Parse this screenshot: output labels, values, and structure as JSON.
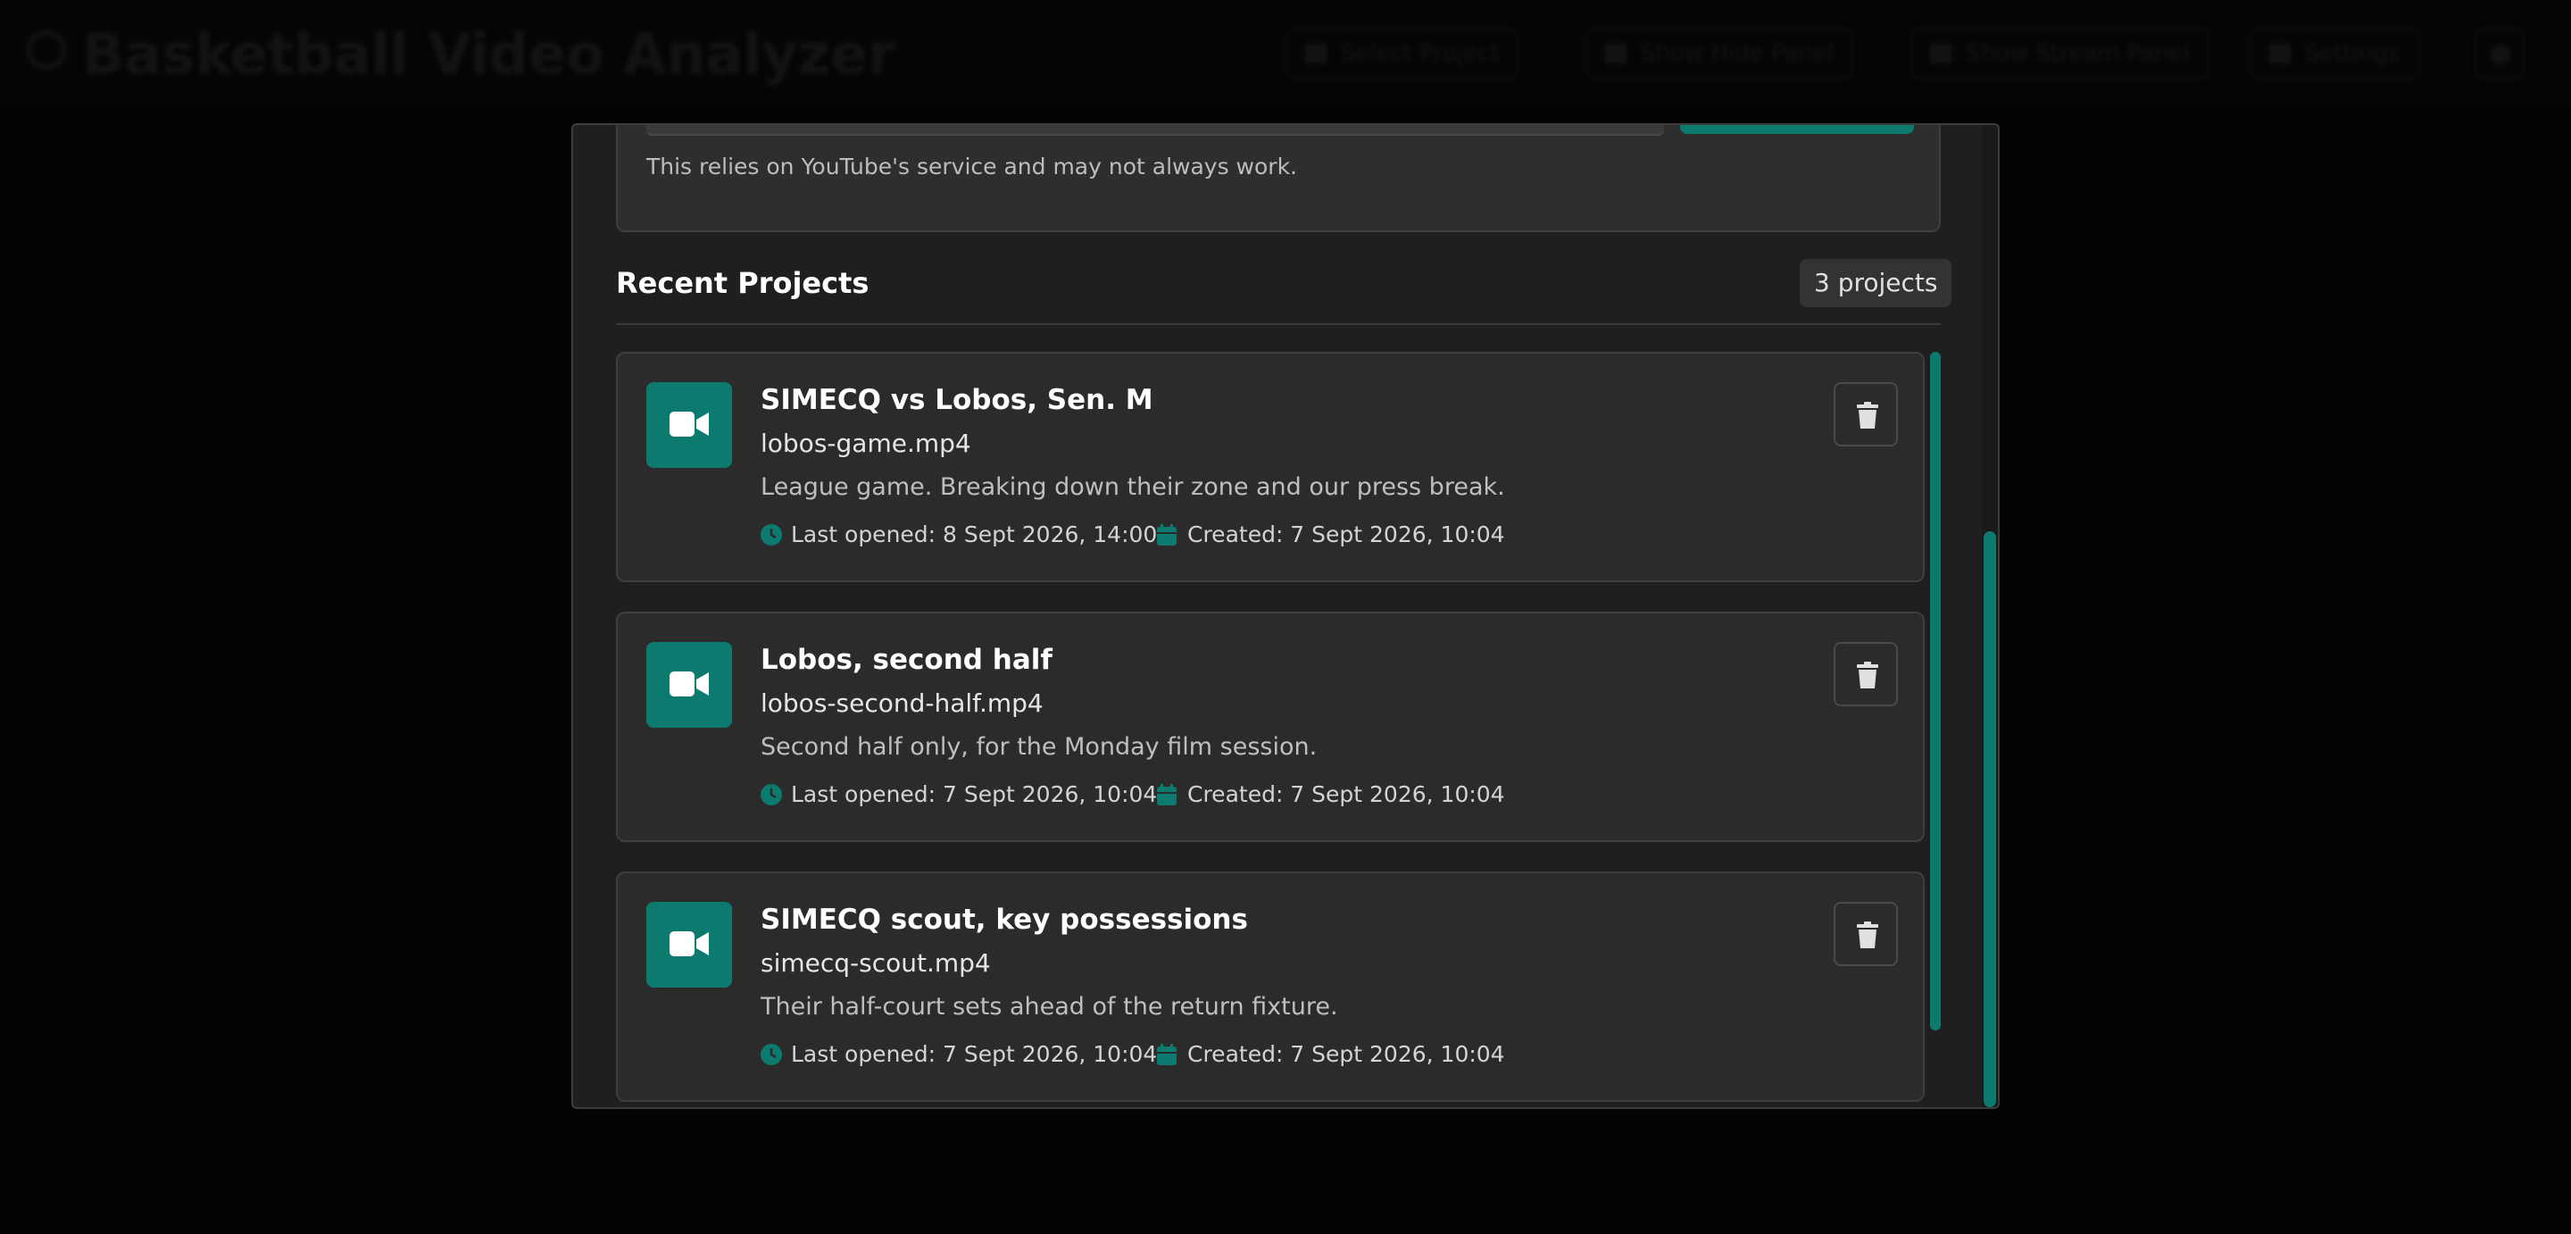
{
  "app": {
    "title": "Basketball Video Analyzer",
    "header_buttons": [
      {
        "label": "Select Project",
        "icon": "folder-icon"
      },
      {
        "label": "Show Hide Panel",
        "icon": "panel-icon"
      },
      {
        "label": "Show Stream Panel",
        "icon": "stream-icon"
      },
      {
        "label": "Settings",
        "icon": "gear-icon"
      }
    ]
  },
  "modal": {
    "youtube_note": "This relies on YouTube's service and may not always work.",
    "recent_title": "Recent Projects",
    "project_count": "3 projects",
    "projects": [
      {
        "title": "SIMECQ vs Lobos, Sen. M",
        "file": "lobos-game.mp4",
        "description": "League game. Breaking down their zone and our press break.",
        "last_opened": "Last opened: 8 Sept 2026, 14:00",
        "created": "Created: 7 Sept 2026, 10:04"
      },
      {
        "title": "Lobos, second half",
        "file": "lobos-second-half.mp4",
        "description": "Second half only, for the Monday film session.",
        "last_opened": "Last opened: 7 Sept 2026, 10:04",
        "created": "Created: 7 Sept 2026, 10:04"
      },
      {
        "title": "SIMECQ scout, key possessions",
        "file": "simecq-scout.mp4",
        "description": "Their half-court sets ahead of the return fixture.",
        "last_opened": "Last opened: 7 Sept 2026, 10:04",
        "created": "Created: 7 Sept 2026, 10:04"
      }
    ]
  },
  "colors": {
    "accent": "#0d7a70",
    "background": "#050505",
    "modal": "#1f1f1f",
    "card": "#2b2b2b"
  }
}
